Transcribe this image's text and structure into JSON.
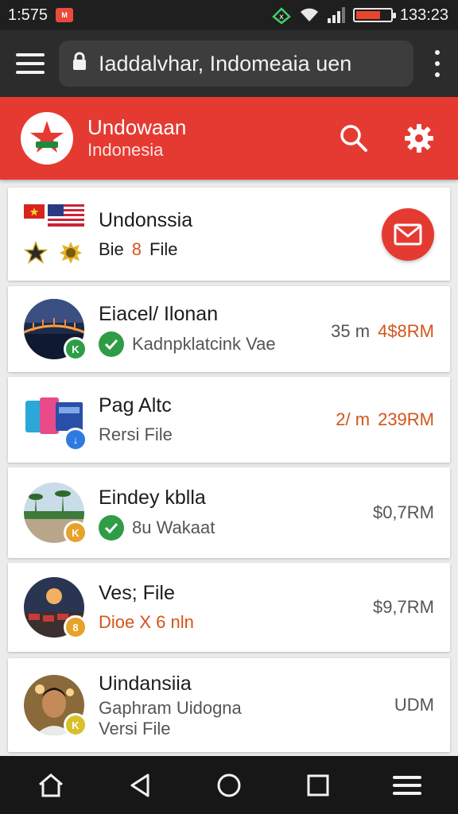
{
  "status_bar": {
    "time_left": "1:575",
    "notification_app": "M",
    "time_right": "133:23",
    "battery_level": 0.72
  },
  "browser": {
    "url": "Iaddalvhar, Indomeaia uen"
  },
  "app_header": {
    "title": "Undowaan",
    "subtitle": "Indonesia"
  },
  "items": [
    {
      "title": "Undonssia",
      "subtitle_pre": "Bie",
      "subtitle_highlight": "8",
      "subtitle_post": "File",
      "action": "mail-fab"
    },
    {
      "title": "Eiacel/ Ilonan",
      "subtitle": "Kadnpklatcink Vae",
      "verified": true,
      "badge_text": "K",
      "duration": "35 m",
      "price": "4$8RM"
    },
    {
      "title": "Pag Altc",
      "subtitle": "Rersi File",
      "verified": false,
      "badge_text": "↓",
      "duration": "2/ m",
      "price": "239RM"
    },
    {
      "title": "Eindey kblla",
      "subtitle": "8u Wakaat",
      "verified": true,
      "badge_text": "K",
      "price": "$0,7RM"
    },
    {
      "title": "Ves; File",
      "subtitle": "Dioe X 6 nln",
      "verified": false,
      "badge_text": "8",
      "price": "$9,7RM"
    },
    {
      "title": "Uindansiia",
      "subtitle": "Gaphram Uidogna",
      "subtitle2": "Versi File",
      "verified": false,
      "badge_text": "K",
      "price": "UDM"
    }
  ],
  "colors": {
    "brand_red": "#e53a32",
    "accent_orange": "#d3541b",
    "verified_green": "#2e9d46"
  }
}
